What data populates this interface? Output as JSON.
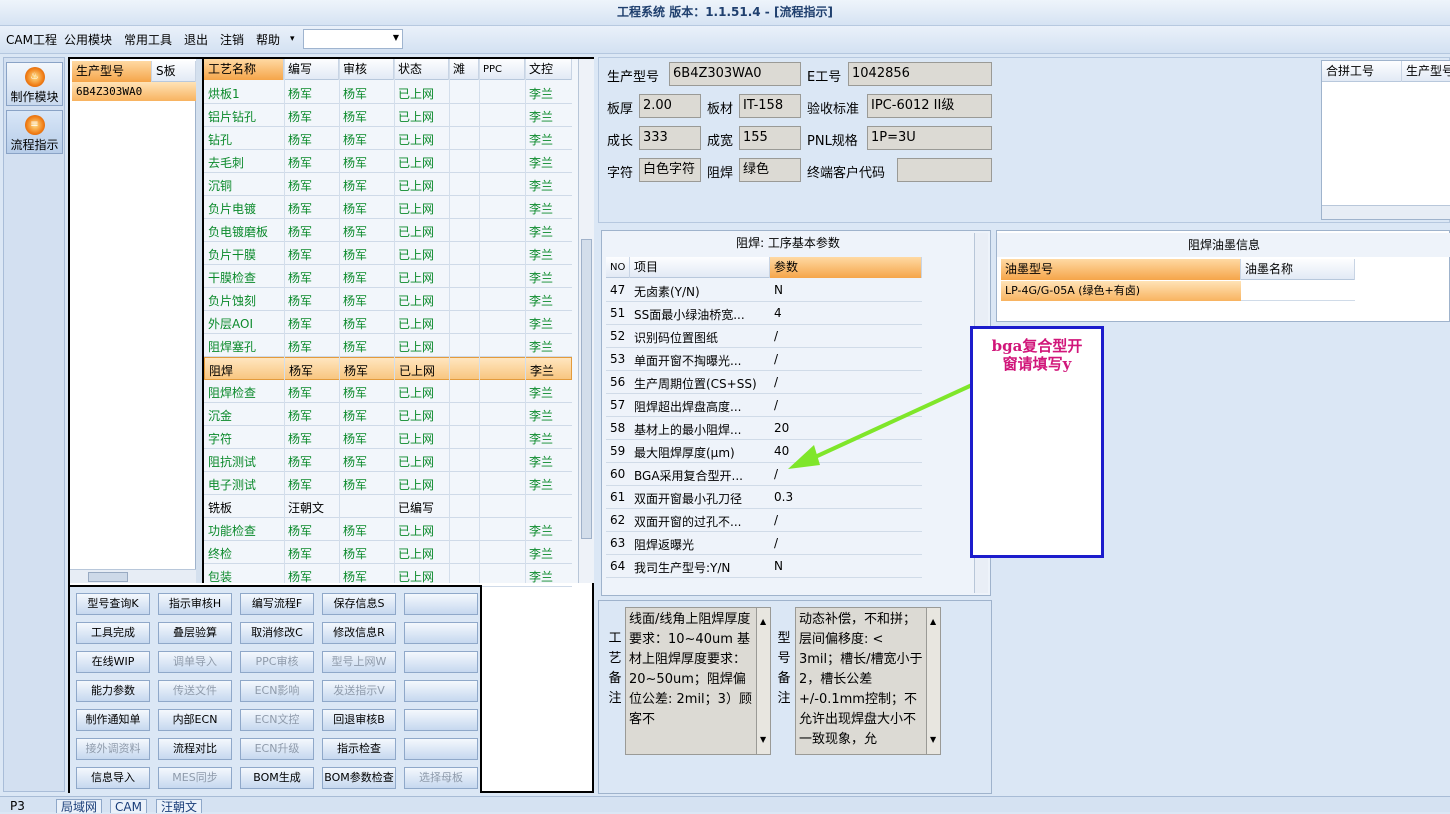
{
  "title": "工程系统  版本：1.1.51.4 - [流程指示]",
  "menu": [
    "CAM工程",
    "公用模块",
    "常用工具",
    "退出",
    "注销",
    "帮助"
  ],
  "menu_dropdown_arrow": "▾",
  "left_nav": [
    {
      "label": "制作模块",
      "icon": "fire-icon"
    },
    {
      "label": "流程指示",
      "icon": "process-icon"
    }
  ],
  "model_grid": {
    "headers": [
      "生产型号",
      "S板"
    ],
    "rows": [
      [
        "6B4Z303WA0"
      ]
    ]
  },
  "process_grid": {
    "headers": [
      "工艺名称",
      "编写",
      "审核",
      "状态",
      "滩",
      "PPC",
      "文控"
    ],
    "rows": [
      [
        "烘板1",
        "杨军",
        "杨军",
        "已上网",
        "李兰"
      ],
      [
        "铝片钻孔",
        "杨军",
        "杨军",
        "已上网",
        "李兰"
      ],
      [
        "钻孔",
        "杨军",
        "杨军",
        "已上网",
        "李兰"
      ],
      [
        "去毛刺",
        "杨军",
        "杨军",
        "已上网",
        "李兰"
      ],
      [
        "沉铜",
        "杨军",
        "杨军",
        "已上网",
        "李兰"
      ],
      [
        "负片电镀",
        "杨军",
        "杨军",
        "已上网",
        "李兰"
      ],
      [
        "负电镀磨板",
        "杨军",
        "杨军",
        "已上网",
        "李兰"
      ],
      [
        "负片干膜",
        "杨军",
        "杨军",
        "已上网",
        "李兰"
      ],
      [
        "干膜检查",
        "杨军",
        "杨军",
        "已上网",
        "李兰"
      ],
      [
        "负片蚀刻",
        "杨军",
        "杨军",
        "已上网",
        "李兰"
      ],
      [
        "外层AOI",
        "杨军",
        "杨军",
        "已上网",
        "李兰"
      ],
      [
        "阻焊塞孔",
        "杨军",
        "杨军",
        "已上网",
        "李兰"
      ],
      [
        "阻焊",
        "杨军",
        "杨军",
        "已上网",
        "李兰"
      ],
      [
        "阻焊检查",
        "杨军",
        "杨军",
        "已上网",
        "李兰"
      ],
      [
        "沉金",
        "杨军",
        "杨军",
        "已上网",
        "李兰"
      ],
      [
        "字符",
        "杨军",
        "杨军",
        "已上网",
        "李兰"
      ],
      [
        "阻抗测试",
        "杨军",
        "杨军",
        "已上网",
        "李兰"
      ],
      [
        "电子测试",
        "杨军",
        "杨军",
        "已上网",
        "李兰"
      ],
      [
        "铣板",
        "汪朝文",
        "",
        "已编写",
        ""
      ],
      [
        "功能检查",
        "杨军",
        "杨军",
        "已上网",
        "李兰"
      ],
      [
        "终检",
        "杨军",
        "杨军",
        "已上网",
        "李兰"
      ],
      [
        "包装",
        "杨军",
        "杨军",
        "已上网",
        "李兰"
      ]
    ],
    "selected_row": 12
  },
  "buttons": [
    [
      "型号查询K",
      "指示审核H",
      "编写流程F",
      "保存信息S",
      ""
    ],
    [
      "工具完成",
      "叠层验算",
      "取消修改C",
      "修改信息R",
      ""
    ],
    [
      "在线WIP",
      "调单导入",
      "PPC审核",
      "型号上网W",
      ""
    ],
    [
      "能力参数",
      "传送文件",
      "ECN影响",
      "发送指示V",
      ""
    ],
    [
      "制作通知单",
      "内部ECN",
      "ECN文控",
      "回退审核B",
      ""
    ],
    [
      "接外调资料",
      "流程对比",
      "ECN升级",
      "指示检查",
      ""
    ],
    [
      "信息导入",
      "MES同步",
      "BOM生成",
      "BOM参数检查",
      "选择母板"
    ]
  ],
  "disabled_buttons": [
    "调单导入",
    "PPC审核",
    "型号上网W",
    "传送文件",
    "ECN影响",
    "发送指示V",
    "ECN文控",
    "接外调资料",
    "ECN升级",
    "MES同步",
    "选择母板"
  ],
  "info": {
    "model_label": "生产型号",
    "model": "6B4Z303WA0",
    "e_label": "E工号",
    "e": "1042856",
    "thick_label": "板厚",
    "thick": "2.00",
    "mat_label": "板材",
    "mat": "IT-158",
    "std_label": "验收标准",
    "std": "IPC-6012 II级",
    "len_label": "成长",
    "len": "333",
    "wid_label": "成宽",
    "wid": "155",
    "pnl_label": "PNL规格",
    "pnl": "1P=3U",
    "char_label": "字符",
    "char": "白色字符",
    "sm_label": "阻焊",
    "sm": "绿色",
    "cust_label": "终端客户代码",
    "cust": ""
  },
  "combo_grid_headers": [
    "合拼工号",
    "生产型号"
  ],
  "params": {
    "title": "阻焊: 工序基本参数",
    "headers": [
      "NO",
      "项目",
      "参数"
    ],
    "rows": [
      [
        "47",
        "无卤素(Y/N)",
        "N"
      ],
      [
        "51",
        "SS面最小绿油桥宽...",
        "4"
      ],
      [
        "52",
        "识别码位置图纸",
        "/"
      ],
      [
        "53",
        "单面开窗不掏曝光...",
        "/"
      ],
      [
        "56",
        "生产周期位置(CS+SS)",
        "/"
      ],
      [
        "57",
        "阻焊超出焊盘高度...",
        "/"
      ],
      [
        "58",
        "基材上的最小阻焊...",
        "20"
      ],
      [
        "59",
        "最大阻焊厚度(μm)",
        "40"
      ],
      [
        "60",
        "BGA采用复合型开...",
        "/"
      ],
      [
        "61",
        "双面开窗最小孔刀径",
        "0.3"
      ],
      [
        "62",
        "双面开窗的过孔不...",
        "/"
      ],
      [
        "63",
        "阻焊返曝光",
        "/"
      ],
      [
        "64",
        "我司生产型号:Y/N",
        "N"
      ]
    ]
  },
  "ink": {
    "title": "阻焊油墨信息",
    "headers": [
      "油墨型号",
      "油墨名称"
    ],
    "row": [
      "LP-4G/G-05A (绿色+有卤)",
      ""
    ]
  },
  "notes": {
    "process_label": "工艺备注",
    "process_text": "线面/线角上阻焊厚度要求：10~40um 基材上阻焊厚度要求：20~50um；阻焊偏位公差: 2mil；3）顾客不",
    "model_label": "型号备注",
    "model_text": "动态补偿，不和拼；层间偏移度: < 3mil；槽长/槽宽小于2，槽长公差+/-0.1mm控制；不允许出现焊盘大小不一致现象，允"
  },
  "annotation": {
    "line1": "bga复合型开",
    "line2": "窗请填写y",
    "arrow_color": "#7fe62a",
    "border_color": "#1c1ccc",
    "text_color": "#d1167a"
  },
  "status_tabs": [
    "P3",
    "局域网",
    "CAM",
    "汪朝文"
  ]
}
